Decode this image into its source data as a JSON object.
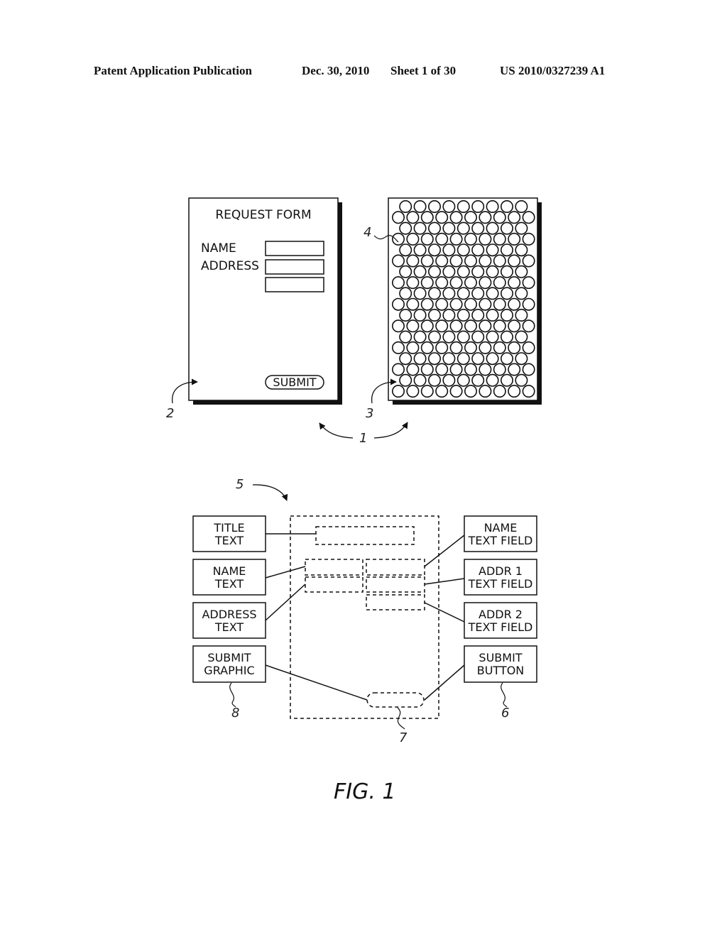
{
  "header": {
    "publication": "Patent Application Publication",
    "date": "Dec. 30, 2010",
    "sheet": "Sheet 1 of 30",
    "number": "US 2010/0327239 A1"
  },
  "form_page": {
    "title": "REQUEST FORM",
    "name_label": "NAME",
    "address_label": "ADDRESS",
    "submit_label": "SUBMIT"
  },
  "tag_page": {
    "rows": 18,
    "pattern": "alternating 9 and 10 circles per row, top row 9"
  },
  "reference_numerals": {
    "interactive_document": "1",
    "form_page": "2",
    "tag_page": "3",
    "tag": "4",
    "page_description": "5",
    "submit_button_ref": "6",
    "submit_zone": "7",
    "submit_graphic_ref": "8"
  },
  "element_boxes": {
    "left": [
      {
        "line1": "TITLE",
        "line2": "TEXT"
      },
      {
        "line1": "NAME",
        "line2": "TEXT"
      },
      {
        "line1": "ADDRESS",
        "line2": "TEXT"
      },
      {
        "line1": "SUBMIT",
        "line2": "GRAPHIC"
      }
    ],
    "right": [
      {
        "line1": "NAME",
        "line2": "TEXT FIELD"
      },
      {
        "line1": "ADDR 1",
        "line2": "TEXT FIELD"
      },
      {
        "line1": "ADDR 2",
        "line2": "TEXT FIELD"
      },
      {
        "line1": "SUBMIT",
        "line2": "BUTTON"
      }
    ]
  },
  "figure_caption": "FIG. 1"
}
